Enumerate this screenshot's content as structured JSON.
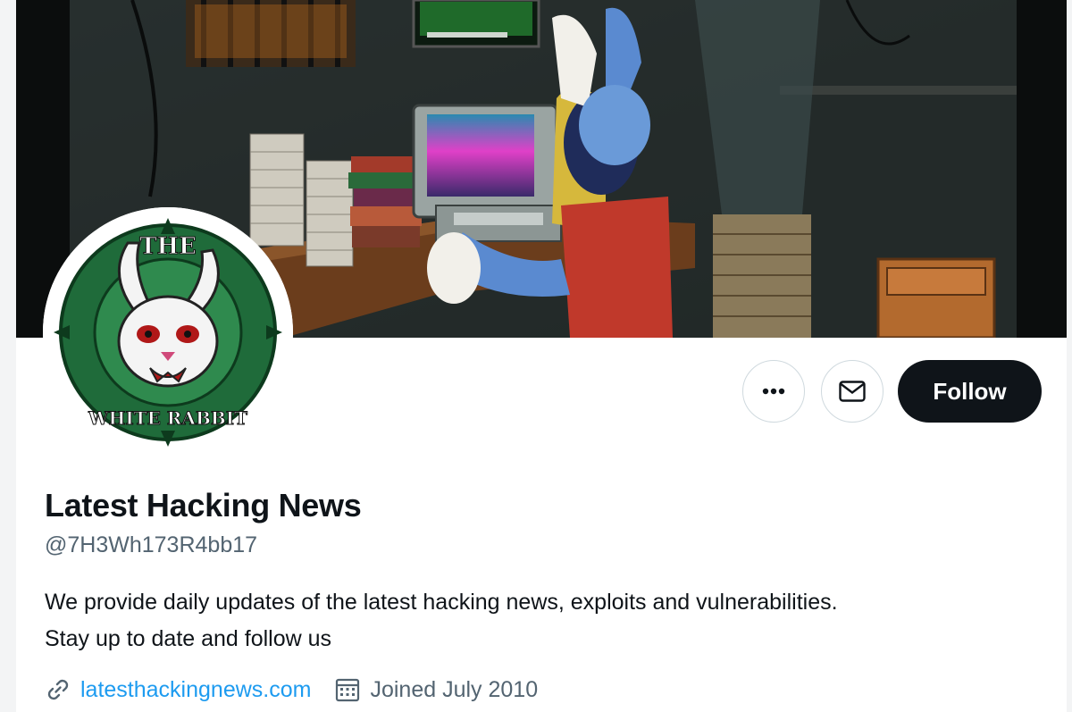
{
  "profile": {
    "display_name": "Latest Hacking News",
    "handle": "@7H3Wh173R4bb17",
    "bio_line1": "We provide daily updates of the latest hacking news, exploits and vulnerabilities.",
    "bio_line2": "Stay up to date and follow us",
    "website": "latesthackingnews.com",
    "joined": "Joined July 2010"
  },
  "actions": {
    "more_icon": "more-dots-icon",
    "message_icon": "envelope-icon",
    "follow_label": "Follow"
  },
  "avatar": {
    "logo_text_top": "THE",
    "logo_text_bottom": "WHITE RABBIT"
  },
  "colors": {
    "link": "#1d9bf0",
    "secondary_text": "#536471",
    "primary_text": "#0f1419",
    "follow_bg": "#0f1419",
    "avatar_ring": "#1f6b3a"
  }
}
